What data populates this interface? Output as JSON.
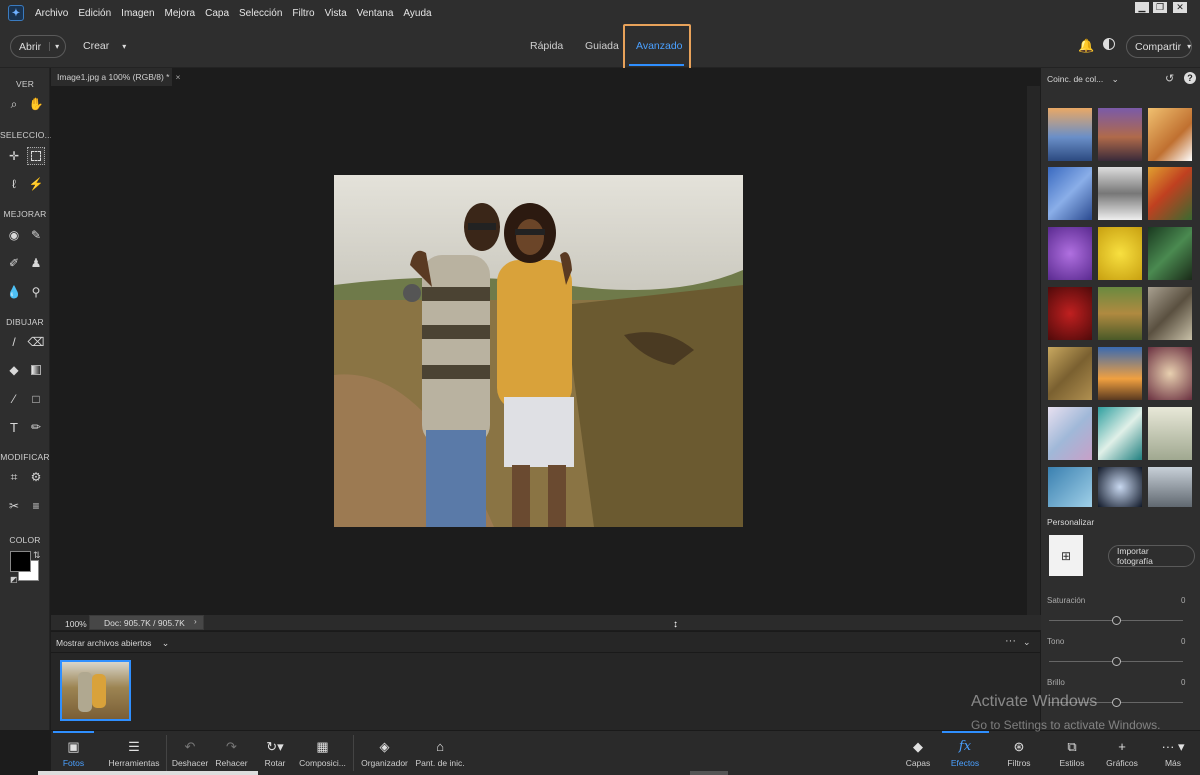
{
  "menubar": {
    "items": [
      "Archivo",
      "Edición",
      "Imagen",
      "Mejora",
      "Capa",
      "Selección",
      "Filtro",
      "Vista",
      "Ventana",
      "Ayuda"
    ]
  },
  "toolbar": {
    "open_label": "Abrir",
    "create_label": "Crear",
    "modes": [
      "Rápida",
      "Guiada",
      "Avanzado"
    ],
    "active_mode": "Avanzado",
    "share_label": "Compartir",
    "accent": "#2f8fff",
    "highlight": "#e8a25a"
  },
  "tools": {
    "sections": [
      "VER",
      "SELECCIO...",
      "MEJORAR",
      "DIBUJAR",
      "MODIFICAR",
      "COLOR"
    ]
  },
  "document": {
    "tab_title": "Image1.jpg a 100% (RGB/8) *",
    "zoom": "100%",
    "doc_size": "Doc: 905.7K / 905.7K"
  },
  "bin": {
    "label": "Mostrar archivos abiertos"
  },
  "panel": {
    "dropdown": "Coinc. de col...",
    "personalize": "Personalizar",
    "import_label": "Importar fotografía",
    "sliders": [
      {
        "label": "Saturación",
        "value": "0"
      },
      {
        "label": "Tono",
        "value": "0"
      },
      {
        "label": "Brillo",
        "value": "0"
      }
    ]
  },
  "bottom": {
    "left": [
      "Fotos",
      "Herramientas",
      "Deshacer",
      "Rehacer",
      "Rotar",
      "Composici...",
      "Organizador",
      "Pant. de inic."
    ],
    "right": [
      "Capas",
      "Efectos",
      "Filtros",
      "Estilos",
      "Gráficos",
      "Más"
    ]
  },
  "watermark": {
    "title": "Activate Windows",
    "subtitle": "Go to Settings to activate Windows."
  }
}
